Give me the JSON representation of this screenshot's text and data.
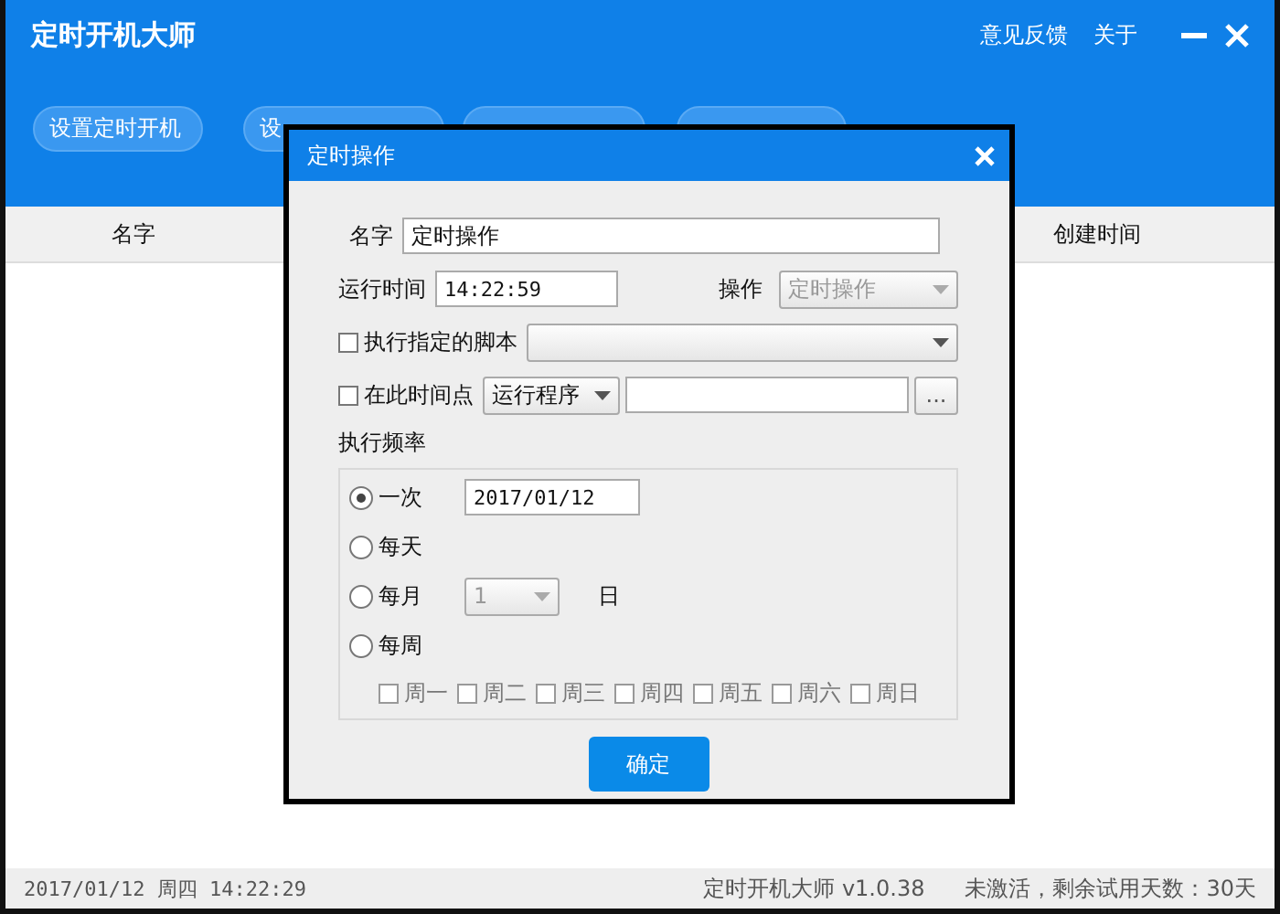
{
  "window": {
    "title": "定时开机大师",
    "links": [
      "意见反馈",
      "关于"
    ]
  },
  "toolbar": [
    {
      "label": "设置定时开机"
    },
    {
      "label": "设"
    }
  ],
  "table": {
    "columns": [
      "名字",
      "创建时间"
    ]
  },
  "dialog": {
    "title": "定时操作",
    "name": {
      "label": "名字",
      "value": "定时操作"
    },
    "run_time": {
      "label": "运行时间",
      "value": "14:22:59"
    },
    "operation": {
      "label": "操作",
      "value": "定时操作",
      "disabled": true
    },
    "script": {
      "label": "执行指定的脚本",
      "checked": false
    },
    "at_time": {
      "label": "在此时间点",
      "checked": false,
      "action": "运行程序",
      "browse": "..."
    },
    "frequency": {
      "label": "执行频率",
      "options": [
        {
          "label": "一次",
          "selected": true,
          "kind": "date",
          "value": "2017/01/12"
        },
        {
          "label": "每天",
          "selected": false,
          "kind": "plain"
        },
        {
          "label": "每月",
          "selected": false,
          "kind": "day",
          "value": "1",
          "disabled": true,
          "suffix": "日"
        },
        {
          "label": "每周",
          "selected": false,
          "kind": "plain"
        }
      ],
      "weekdays": [
        {
          "label": "周一",
          "checked": false,
          "disabled": true
        },
        {
          "label": "周二",
          "checked": false,
          "disabled": true
        },
        {
          "label": "周三",
          "checked": false,
          "disabled": true
        },
        {
          "label": "周四",
          "checked": false,
          "disabled": true
        },
        {
          "label": "周五",
          "checked": false,
          "disabled": true
        },
        {
          "label": "周六",
          "checked": false,
          "disabled": true
        },
        {
          "label": "周日",
          "checked": false,
          "disabled": true
        }
      ]
    },
    "ok": "确定"
  },
  "status_bar": {
    "datetime": "2017/01/12 周四 14:22:29",
    "version": "定时开机大师 v1.0.38",
    "license": "未激活，剩余试用天数：30天"
  }
}
